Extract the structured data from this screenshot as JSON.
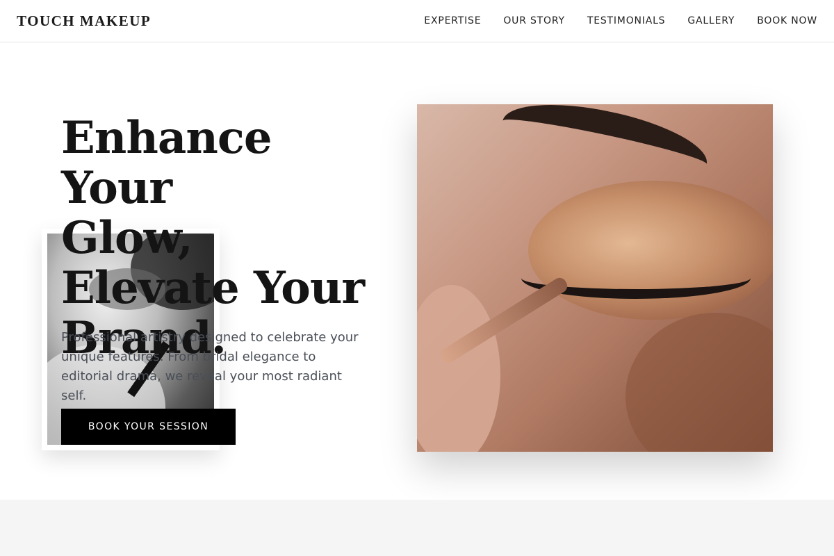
{
  "brand": {
    "name": "TOUCH MAKEUP"
  },
  "nav": {
    "items": [
      {
        "label": "EXPERTISE"
      },
      {
        "label": "OUR STORY"
      },
      {
        "label": "TESTIMONIALS"
      },
      {
        "label": "GALLERY"
      },
      {
        "label": "BOOK NOW"
      }
    ]
  },
  "hero": {
    "headline_line1": "Enhance Your",
    "headline_line2": "Glow,",
    "headline_line3": "Elevate Your",
    "headline_line4": "Brand.",
    "description": "Professional artistry designed to celebrate your unique features. From bridal elegance to editorial drama, we reveal your most radiant self.",
    "cta_label": "BOOK YOUR SESSION"
  },
  "colors": {
    "text_dark": "#141414",
    "body_text": "#4a4f57",
    "cta_bg": "#000000",
    "band_bg": "#f5f5f5"
  }
}
